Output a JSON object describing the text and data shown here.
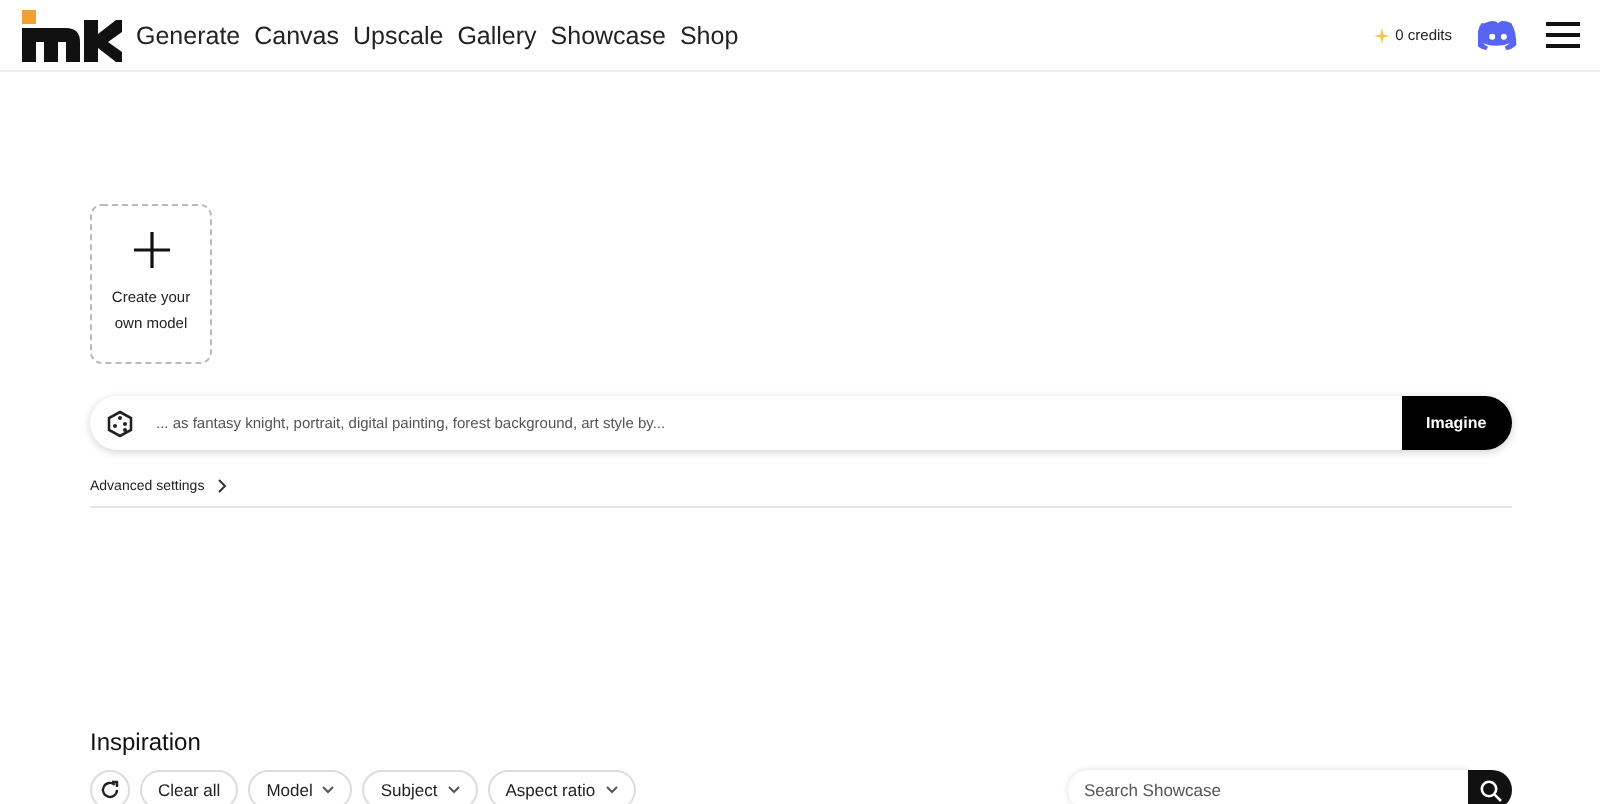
{
  "nav": {
    "items": [
      "Generate",
      "Canvas",
      "Upscale",
      "Gallery",
      "Showcase",
      "Shop"
    ],
    "credits": "0 credits"
  },
  "model_card": {
    "label": "Create your own model"
  },
  "prompt": {
    "placeholder": "... as fantasy knight, portrait, digital painting, forest background, art style by...",
    "button": "Imagine"
  },
  "advanced_settings": {
    "label": "Advanced settings",
    "expanded": false
  },
  "inspiration": {
    "title": "Inspiration",
    "filters": [
      {
        "label": "Clear all",
        "kind": "button"
      },
      {
        "label": "Model",
        "kind": "dropdown"
      },
      {
        "label": "Subject",
        "kind": "dropdown"
      },
      {
        "label": "Aspect ratio",
        "kind": "dropdown"
      }
    ],
    "search": {
      "placeholder": "Search Showcase"
    }
  }
}
